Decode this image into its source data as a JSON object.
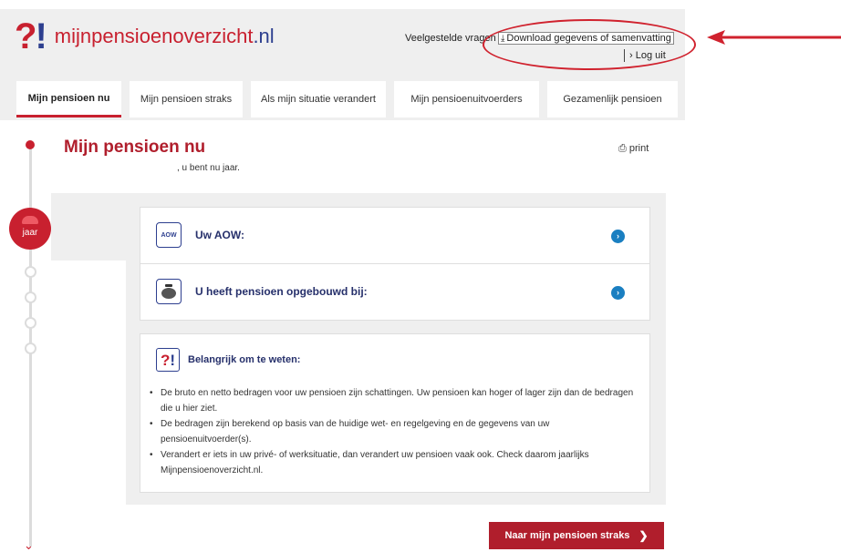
{
  "header": {
    "logo_text": "mijnpensioenoverzicht",
    "logo_tld": ".nl",
    "faq_label": "Veelgestelde vragen",
    "download_label": "Download gegevens of samenvatting",
    "logout_label": "› Log uit"
  },
  "tabs": [
    {
      "label": "Mijn pensioen nu"
    },
    {
      "label": "Mijn pensioen straks"
    },
    {
      "label": "Als mijn situatie verandert"
    },
    {
      "label": "Mijn pensioenuitvoerders"
    },
    {
      "label": "Gezamenlijk pensioen"
    }
  ],
  "page": {
    "title": "Mijn pensioen nu",
    "subtitle": ", u bent nu     jaar.",
    "print_label": "print",
    "timeline_marker_label": "jaar"
  },
  "rows": {
    "aow_icon_text": "AOW",
    "aow_label": "Uw AOW:",
    "pension_label": "U heeft pensioen opgebouwd bij:"
  },
  "info": {
    "title": "Belangrijk om te weten:",
    "items": [
      "De bruto en netto bedragen voor uw pensioen zijn schattingen. Uw pensioen kan hoger of lager zijn dan de bedragen die u hier ziet.",
      "De bedragen zijn berekend op basis van de huidige wet- en regelgeving en de gegevens van uw pensioenuitvoerder(s).",
      "Verandert er iets in uw privé- of werksituatie, dan verandert uw pensioen vaak ook. Check daarom jaarlijks Mijnpensioenoverzicht.nl."
    ]
  },
  "footer": {
    "next_label": "Naar mijn pensioen straks"
  },
  "colors": {
    "brand_red": "#c8202f",
    "brand_blue": "#2d3f8f",
    "chevron_blue": "#1a7fc1",
    "annotation_red": "#d0222e"
  }
}
